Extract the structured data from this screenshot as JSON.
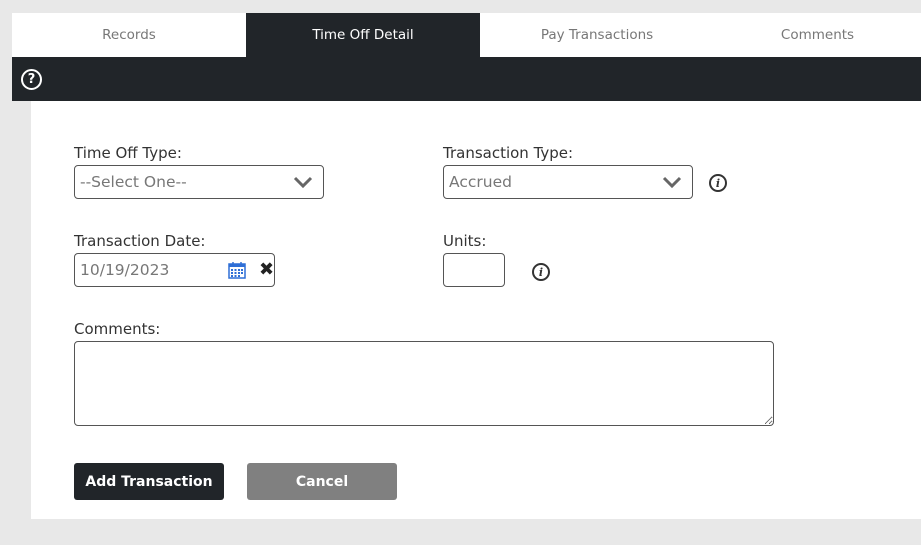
{
  "tabs": [
    {
      "label": "Records"
    },
    {
      "label": "Time Off Detail"
    },
    {
      "label": "Pay Transactions"
    },
    {
      "label": "Comments"
    }
  ],
  "toolbar": {
    "help_glyph": "?",
    "help_icon": "help-circle-icon"
  },
  "form": {
    "time_off_type": {
      "label": "Time Off Type:",
      "value": "--Select One--"
    },
    "transaction_type": {
      "label": "Transaction Type:",
      "value": "Accrued"
    },
    "transaction_date": {
      "label": "Transaction Date:",
      "value": "10/19/2023"
    },
    "units": {
      "label": "Units:",
      "value": ""
    },
    "comments": {
      "label": "Comments:",
      "value": ""
    },
    "info_glyph": "i"
  },
  "buttons": {
    "add_label": "Add Transaction",
    "cancel_label": "Cancel"
  },
  "colors": {
    "dark": "#212529",
    "secondary_button": "#808080",
    "calendar_icon": "#2f6fd6",
    "background": "#e8e8e8"
  }
}
